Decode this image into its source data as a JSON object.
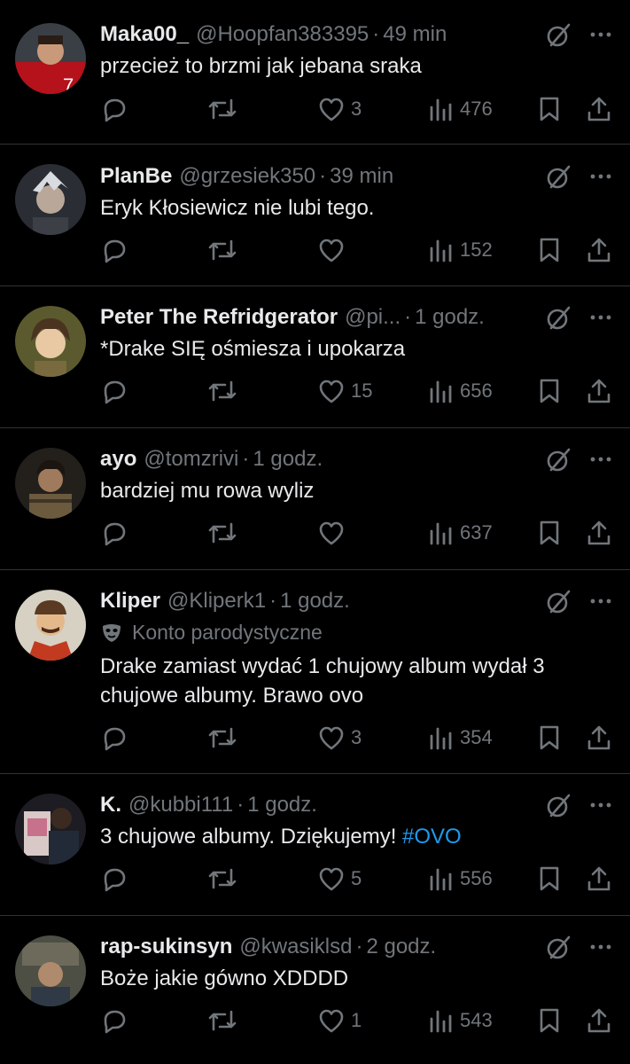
{
  "tweets": [
    {
      "name": "Maka00_",
      "handle": "@Hoopfan383395",
      "time": "49 min",
      "text": "przecież to brzmi jak jebana sraka",
      "likes": "3",
      "views": "476"
    },
    {
      "name": "PlanBe",
      "handle": "@grzesiek350",
      "time": "39 min",
      "text": "Eryk Kłosiewicz nie lubi tego.",
      "likes": "",
      "views": "152"
    },
    {
      "name": "Peter The Refridgerator",
      "handle": "@pi...",
      "time": "1 godz.",
      "text": "*Drake SIĘ ośmiesza i upokarza",
      "likes": "15",
      "views": "656"
    },
    {
      "name": "ayo",
      "handle": "@tomzrivi",
      "time": "1 godz.",
      "text": "bardziej mu rowa wyliz",
      "likes": "",
      "views": "637"
    },
    {
      "name": "Kliper",
      "handle": "@Kliperk1",
      "time": "1 godz.",
      "parody_label": "Konto parodystyczne",
      "text": "Drake zamiast wydać 1 chujowy album wydał 3 chujowe albumy. Brawo ovo",
      "likes": "3",
      "views": "354"
    },
    {
      "name": "K.",
      "handle": "@kubbi111",
      "time": "1 godz.",
      "text": "3 chujowe albumy. Dziękujemy!",
      "hashtag": "#OVO",
      "likes": "5",
      "views": "556"
    },
    {
      "name": "rap-sukinsyn",
      "handle": "@kwasiklsd",
      "time": "2 godz.",
      "text": "Boże jakie gówno XDDDD",
      "likes": "1",
      "views": "543"
    }
  ],
  "colors": {
    "background": "#000000",
    "text": "#e7e9ea",
    "secondary": "#71767b",
    "divider": "#2f3336",
    "link": "#1d9bf0"
  },
  "icons": [
    "reply-icon",
    "retweet-icon",
    "like-icon",
    "views-icon",
    "bookmark-icon",
    "share-icon",
    "grok-icon",
    "more-icon",
    "parody-mask-icon"
  ]
}
